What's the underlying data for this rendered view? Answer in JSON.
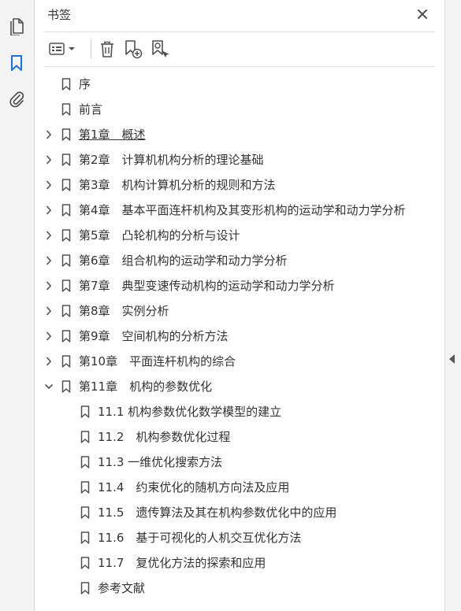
{
  "panel": {
    "title": "书签"
  },
  "rail": {
    "items": [
      {
        "icon": "pages-icon"
      },
      {
        "icon": "bookmark-icon",
        "active": true
      },
      {
        "icon": "attachment-icon"
      }
    ]
  },
  "toolbar": {
    "buttons": [
      {
        "icon": "options-menu-icon"
      },
      {
        "icon": "delete-icon"
      },
      {
        "icon": "add-bookmark-icon"
      },
      {
        "icon": "search-bookmark-icon"
      }
    ]
  },
  "bookmarks": [
    {
      "label": "序",
      "level": 0,
      "expander": "none"
    },
    {
      "label": "前言",
      "level": 0,
      "expander": "none"
    },
    {
      "label": "第1章　概述",
      "level": 0,
      "expander": "collapsed",
      "underline": true
    },
    {
      "label": "第2章　计算机机构分析的理论基础",
      "level": 0,
      "expander": "collapsed"
    },
    {
      "label": "第3章　机构计算机分析的规则和方法",
      "level": 0,
      "expander": "collapsed"
    },
    {
      "label": "第4章　基本平面连杆机构及其变形机构的运动学和动力学分析",
      "level": 0,
      "expander": "collapsed"
    },
    {
      "label": "第5章　凸轮机构的分析与设计",
      "level": 0,
      "expander": "collapsed"
    },
    {
      "label": "第6章　组合机构的运动学和动力学分析",
      "level": 0,
      "expander": "collapsed"
    },
    {
      "label": "第7章　典型变速传动机构的运动学和动力学分析",
      "level": 0,
      "expander": "collapsed"
    },
    {
      "label": "第8章　实例分析",
      "level": 0,
      "expander": "collapsed"
    },
    {
      "label": "第9章　空间机构的分析方法",
      "level": 0,
      "expander": "collapsed"
    },
    {
      "label": "第10章　平面连杆机构的综合",
      "level": 0,
      "expander": "collapsed"
    },
    {
      "label": "第11章　机构的参数优化",
      "level": 0,
      "expander": "expanded"
    },
    {
      "label": "11.1 机构参数优化数学模型的建立",
      "level": 1,
      "expander": "none"
    },
    {
      "label": "11.2　机构参数优化过程",
      "level": 1,
      "expander": "none"
    },
    {
      "label": "11.3 一维优化搜索方法",
      "level": 1,
      "expander": "none"
    },
    {
      "label": "11.4　约束优化的随机方向法及应用",
      "level": 1,
      "expander": "none"
    },
    {
      "label": "11.5　遗传算法及其在机构参数优化中的应用",
      "level": 1,
      "expander": "none"
    },
    {
      "label": "11.6　基于可视化的人机交互优化方法",
      "level": 1,
      "expander": "none"
    },
    {
      "label": "11.7　复优化方法的探索和应用",
      "level": 1,
      "expander": "none"
    },
    {
      "label": "参考文献",
      "level": 1,
      "expander": "none"
    }
  ],
  "colors": {
    "accent": "#1473e6",
    "icon": "#505050",
    "text": "#333333"
  }
}
